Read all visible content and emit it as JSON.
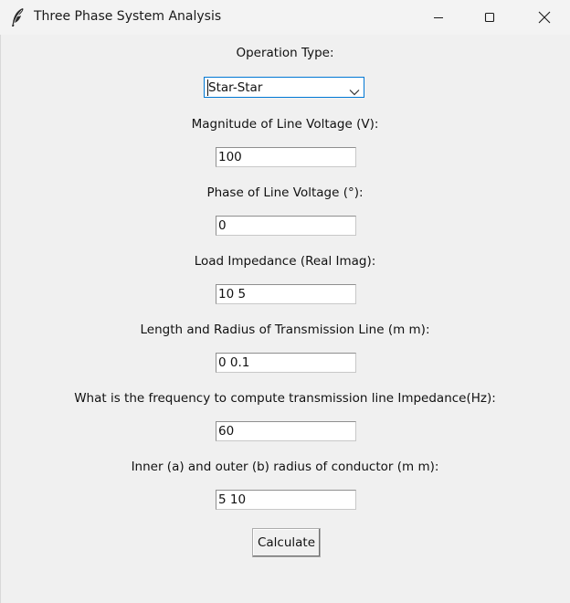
{
  "window": {
    "title": "Three Phase System Analysis",
    "icon": "feather-icon",
    "controls": [
      "minimize-icon",
      "maximize-icon",
      "close-icon"
    ]
  },
  "form": {
    "operation_type": {
      "label": "Operation Type:",
      "value": "Star-Star"
    },
    "line_voltage_magnitude": {
      "label": "Magnitude of Line Voltage (V):",
      "value": "100"
    },
    "line_voltage_phase": {
      "label": "Phase of Line Voltage (°):",
      "value": "0"
    },
    "load_impedance": {
      "label": "Load Impedance (Real Imag):",
      "value": "10 5"
    },
    "transmission_line_dims": {
      "label": "Length and Radius of Transmission Line (m m):",
      "value": "0 0.1"
    },
    "frequency": {
      "label": "What is the frequency to compute transmission line Impedance(Hz):",
      "value": "60"
    },
    "conductor_radii": {
      "label": "Inner (a) and outer (b) radius of conductor (m m):",
      "value": "5 10"
    },
    "calculate_label": "Calculate"
  }
}
